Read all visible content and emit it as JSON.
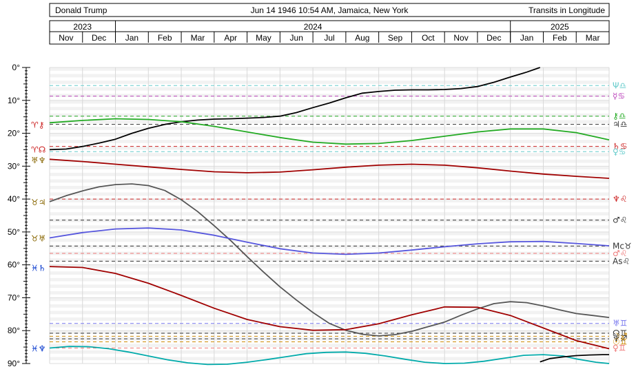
{
  "header": {
    "name": "Donald Trump",
    "birth": "Jun 14 1946 10:54 AM, Jamaica, New York",
    "mode": "Transits in Longitude"
  },
  "chart_data": {
    "type": "line",
    "title": "Transits in Longitude",
    "years": [
      {
        "label": "2023",
        "months": [
          "Nov",
          "Dec"
        ]
      },
      {
        "label": "2024",
        "months": [
          "Jan",
          "Feb",
          "Mar",
          "Apr",
          "May",
          "Jun",
          "Jul",
          "Aug",
          "Sep",
          "Oct",
          "Nov",
          "Dec"
        ]
      },
      {
        "label": "2025",
        "months": [
          "Jan",
          "Feb",
          "Mar"
        ]
      }
    ],
    "months": [
      "Nov",
      "Dec",
      "Jan",
      "Feb",
      "Mar",
      "Apr",
      "May",
      "Jun",
      "Jul",
      "Aug",
      "Sep",
      "Oct",
      "Nov",
      "Dec",
      "Jan",
      "Feb",
      "Mar"
    ],
    "ylim": [
      0,
      90
    ],
    "yticks": [
      "0°",
      "10°",
      "20°",
      "30°",
      "40°",
      "50°",
      "60°",
      "70°",
      "80°",
      "90°"
    ],
    "y_step": 10,
    "grid": true,
    "series": [
      {
        "color": "#00aaaa",
        "marker_start": "♈",
        "marker_end": "♈",
        "x": [
          0,
          0.6,
          1.2,
          1.8,
          2.4,
          3,
          3.6,
          4.2,
          4.8,
          5.4,
          6,
          6.6,
          7.2,
          7.8,
          8.4,
          9,
          9.6,
          10.2,
          10.8,
          11.4,
          12,
          12.6,
          13.2,
          13.8,
          14.4,
          15,
          15.6,
          16,
          16.6,
          17
        ],
        "values": [
          85.3,
          84.8,
          84.9,
          85.5,
          86.5,
          87.7,
          88.9,
          89.8,
          90.3,
          90.2,
          89.6,
          88.8,
          87.9,
          87.0,
          86.6,
          86.5,
          86.9,
          87.7,
          88.7,
          89.6,
          90.0,
          89.9,
          89.3,
          88.4,
          87.5,
          87.3,
          87.7,
          88.6,
          89.6,
          90.0
        ]
      },
      {
        "color": "#000000",
        "x": [
          0,
          0.5,
          1,
          1.5,
          2,
          2.5,
          3,
          3.5,
          4,
          4.5,
          5,
          5.5,
          6,
          6.5,
          7,
          7.5,
          8,
          8.5,
          9,
          9.5,
          10,
          10.5,
          11,
          11.5,
          12,
          12.5,
          13,
          13.5,
          14,
          14.5,
          14.9
        ],
        "values": [
          25,
          24.8,
          24,
          23,
          21.8,
          20,
          18.5,
          17.3,
          16.5,
          16,
          15.7,
          15.6,
          15.4,
          15.2,
          14.8,
          13.7,
          12.2,
          10.8,
          9.2,
          7.8,
          7.3,
          6.9,
          6.8,
          6.8,
          6.7,
          6.4,
          5.8,
          4.5,
          2.9,
          1.4,
          0
        ]
      },
      {
        "color": "#000000",
        "x": [
          14.9,
          15.2,
          15.6,
          16.0,
          16.4,
          16.8,
          17
        ],
        "values": [
          89.5,
          88.5,
          88.0,
          87.6,
          87.4,
          87.3,
          87.3
        ]
      },
      {
        "color": "#22aa22",
        "x": [
          0,
          1,
          2,
          3,
          4,
          5,
          6,
          7,
          8,
          9,
          10,
          11,
          12,
          13,
          14,
          15,
          16,
          17
        ],
        "values": [
          16.8,
          16.1,
          15.6,
          15.8,
          16.5,
          17.9,
          19.6,
          21.3,
          22.7,
          23.3,
          23.1,
          22.2,
          20.9,
          19.6,
          18.7,
          18.7,
          19.8,
          22.0
        ]
      },
      {
        "color": "#a00000",
        "x": [
          0,
          1,
          2,
          3,
          4,
          5,
          6,
          7,
          8,
          9,
          10,
          11,
          12,
          13,
          14,
          15,
          16,
          17
        ],
        "values": [
          27.9,
          28.6,
          29.4,
          30.2,
          31.0,
          31.7,
          32.0,
          31.8,
          31.1,
          30.3,
          29.7,
          29.4,
          29.7,
          30.5,
          31.5,
          32.4,
          33.1,
          33.7
        ]
      },
      {
        "color": "#555555",
        "x": [
          0,
          0.5,
          1,
          1.5,
          2,
          2.5,
          3,
          3.5,
          4,
          4.5,
          5,
          5.5,
          6,
          6.5,
          7,
          7.5,
          8,
          8.5,
          9,
          9.5,
          10,
          10.5,
          11,
          11.5,
          12,
          12.5,
          13,
          13.5,
          14,
          14.5,
          15,
          15.5,
          16,
          16.5,
          17
        ],
        "values": [
          40.8,
          39.0,
          37.5,
          36.3,
          35.6,
          35.4,
          35.9,
          37.4,
          40.2,
          43.8,
          48.1,
          52.6,
          57.5,
          62.2,
          66.7,
          70.7,
          74.5,
          77.8,
          79.9,
          81.1,
          81.6,
          81.2,
          80.2,
          78.8,
          77.4,
          75.3,
          73.4,
          71.8,
          71.2,
          71.5,
          72.5,
          73.7,
          74.8,
          75.4,
          76.0
        ]
      },
      {
        "color": "#5555dd",
        "x": [
          0,
          1,
          2,
          3,
          4,
          5,
          6,
          7,
          8,
          9,
          10,
          11,
          12,
          13,
          14,
          15,
          16,
          17
        ],
        "values": [
          51.8,
          50.2,
          49.1,
          48.8,
          49.4,
          51.0,
          53.1,
          55.1,
          56.4,
          56.8,
          56.4,
          55.5,
          54.5,
          53.6,
          53.0,
          52.9,
          53.5,
          54.2
        ]
      },
      {
        "color": "#a00000",
        "x": [
          0,
          1,
          2,
          3,
          4,
          5,
          6,
          7,
          8,
          9,
          10,
          11,
          12,
          13,
          14,
          15,
          16,
          17
        ],
        "values": [
          60.5,
          60.8,
          62.6,
          65.6,
          69.3,
          73.2,
          76.6,
          78.8,
          79.9,
          79.7,
          77.9,
          75.2,
          72.8,
          72.9,
          75.4,
          79.2,
          83.0,
          85.5
        ]
      }
    ],
    "reference_lines": [
      {
        "value": 5.5,
        "color": "#66cccc",
        "label": "Ψ♎"
      },
      {
        "value": 8.7,
        "color": "#bb44bb",
        "label": "☿♋"
      },
      {
        "value": 14.8,
        "color": "#22aa22",
        "label": "⚷♎"
      },
      {
        "value": 17.3,
        "color": "#333333",
        "label": "♃♎"
      },
      {
        "value": 24.0,
        "color": "#cc2222",
        "label": "♄♋"
      },
      {
        "value": 25.6,
        "color": "#66cccc",
        "label": "♀♋"
      },
      {
        "value": 40.0,
        "color": "#cc2222",
        "label": "♆♌"
      },
      {
        "value": 46.4,
        "color": "#333333",
        "label": "♂♌"
      },
      {
        "value": 54.3,
        "color": "#333333",
        "label": "Mc♉"
      },
      {
        "value": 56.5,
        "color": "#ee7777",
        "label": "♂♌"
      },
      {
        "value": 58.9,
        "color": "#333333",
        "label": "As♌"
      },
      {
        "value": 77.8,
        "color": "#7777ee",
        "label": "♅♊"
      },
      {
        "value": 80.8,
        "color": "#333333",
        "label": "☊♊"
      },
      {
        "value": 81.7,
        "color": "#cc8800",
        "label": "☽♐"
      },
      {
        "value": 82.5,
        "color": "#333333",
        "label": "♆♐"
      },
      {
        "value": 83.4,
        "color": "#cc8800",
        "label": "☉♊"
      },
      {
        "value": 85.3,
        "color": "#ee7777",
        "label": "♀♊"
      }
    ],
    "left_labels": [
      {
        "value": 17.5,
        "text": "♈⚷",
        "color": "#cc2222"
      },
      {
        "value": 25.0,
        "text": "♈☊",
        "color": "#cc2222"
      },
      {
        "value": 28.3,
        "text": "♅♆",
        "color": "#886600"
      },
      {
        "value": 41.0,
        "text": "♉♃",
        "color": "#886600"
      },
      {
        "value": 52.0,
        "text": "♉♅",
        "color": "#886600"
      },
      {
        "value": 61.0,
        "text": "♓♄",
        "color": "#0033cc"
      },
      {
        "value": 85.5,
        "text": "♓♆",
        "color": "#0033cc"
      }
    ]
  }
}
